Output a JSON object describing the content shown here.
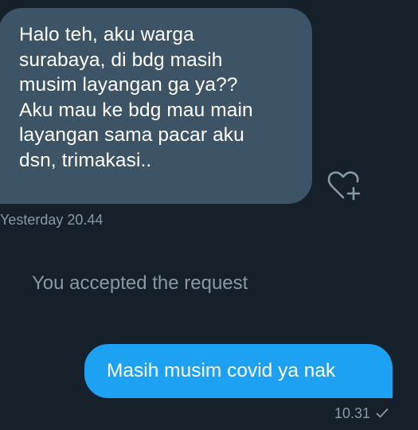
{
  "conversation": {
    "received_message": {
      "text": "Halo teh, aku warga\nsurabaya, di bdg masih\nmusim layangan ga ya??\nAku mau ke bdg mau main\nlayangan sama pacar aku\ndsn, trimakasi..",
      "timestamp": "Yesterday 20.44",
      "reaction_icon": "heart-plus-icon"
    },
    "system_notice": "You accepted the request",
    "sent_message": {
      "text": "Masih musim covid ya nak",
      "timestamp": "10.31",
      "status_icon": "check-icon"
    }
  },
  "colors": {
    "background": "#15202b",
    "received_bubble": "#3d5466",
    "sent_bubble": "#1da1f2",
    "secondary_text": "#8899a6",
    "primary_text": "#ffffff"
  }
}
